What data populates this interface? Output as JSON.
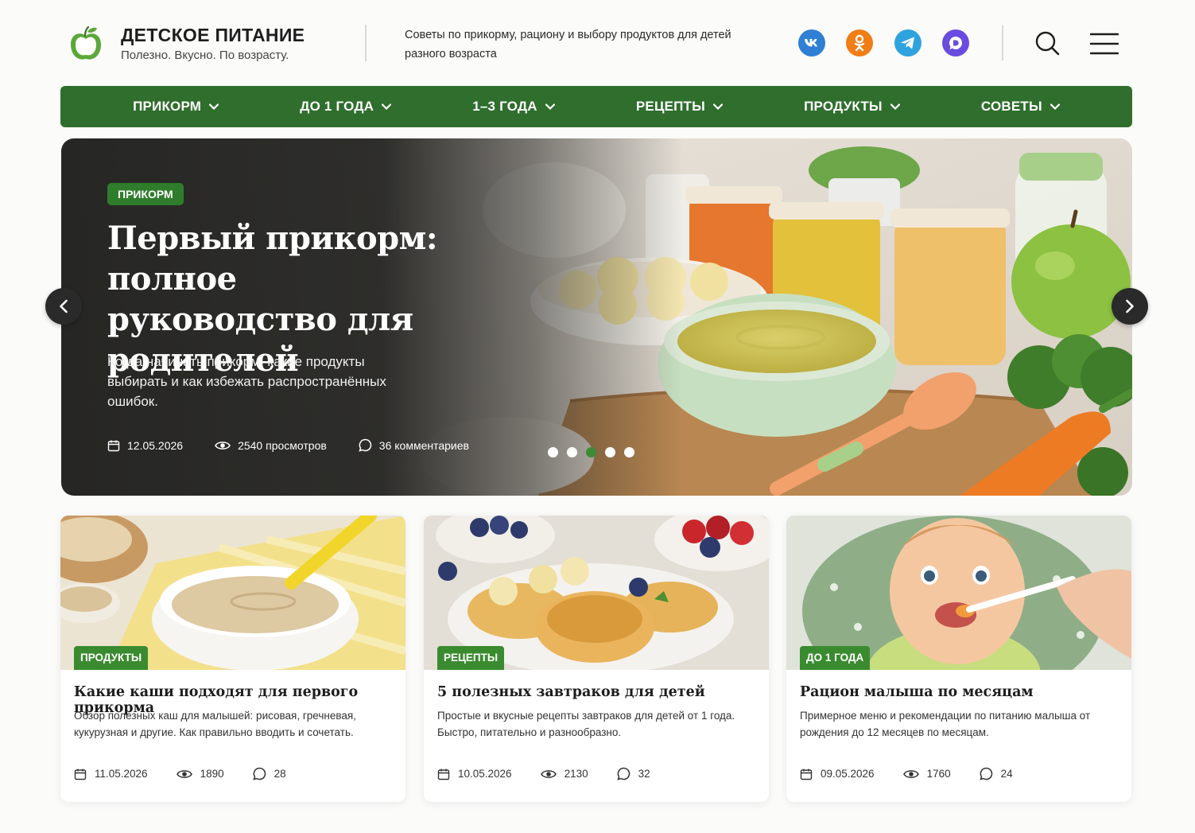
{
  "brand": {
    "title": "ДЕТСКОЕ ПИТАНИЕ",
    "subtitle": "Полезно. Вкусно. По возрасту.",
    "tagline": "Советы по прикорму, рациону и выбору продуктов для детей разного возраста"
  },
  "social": [
    {
      "name": "vk-icon",
      "color": "#2f7fd4"
    },
    {
      "name": "ok-icon",
      "color": "#f07d16"
    },
    {
      "name": "telegram-icon",
      "color": "#2ea3de"
    },
    {
      "name": "max-icon",
      "color": "#6a4be0"
    }
  ],
  "nav": {
    "items": [
      {
        "label": "ПРИКОРМ"
      },
      {
        "label": "ДО 1 ГОДА"
      },
      {
        "label": "1–3 ГОДА"
      },
      {
        "label": "РЕЦЕПТЫ"
      },
      {
        "label": "ПРОДУКТЫ"
      },
      {
        "label": "СОВЕТЫ"
      }
    ]
  },
  "hero": {
    "badge": "ПРИКОРМ",
    "title": "Первый прикорм: полное руководство для родителей",
    "description": "Когда начинать прикорм, какие продукты выбирать и как избежать распространённых ошибок.",
    "date": "12.05.2026",
    "views": "2540 просмотров",
    "comments": "36 комментариев",
    "slides_total": 5,
    "active_slide": 3
  },
  "cards": [
    {
      "badge": "ПРОДУКТЫ",
      "title": "Какие каши подходят для первого прикорма",
      "description": "Обзор полезных каш для малышей: рисовая, гречневая, кукурузная и другие. Как правильно вводить и сочетать.",
      "date": "11.05.2026",
      "views": "1890",
      "comments": "28"
    },
    {
      "badge": "РЕЦЕПТЫ",
      "title": "5 полезных завтраков для детей",
      "description": "Простые и вкусные рецепты завтраков для детей от 1 года. Быстро, питательно и разнообразно.",
      "date": "10.05.2026",
      "views": "2130",
      "comments": "32"
    },
    {
      "badge": "ДО 1 ГОДА",
      "title": "Рацион малыша по месяцам",
      "description": "Примерное меню и рекомендации по питанию малыша от рождения до 12 месяцев по месяцам.",
      "date": "09.05.2026",
      "views": "1760",
      "comments": "24"
    }
  ],
  "colors": {
    "nav_green": "#2f6e2d",
    "badge_green": "#3a8b2f",
    "hero_dark": "#20201e"
  }
}
